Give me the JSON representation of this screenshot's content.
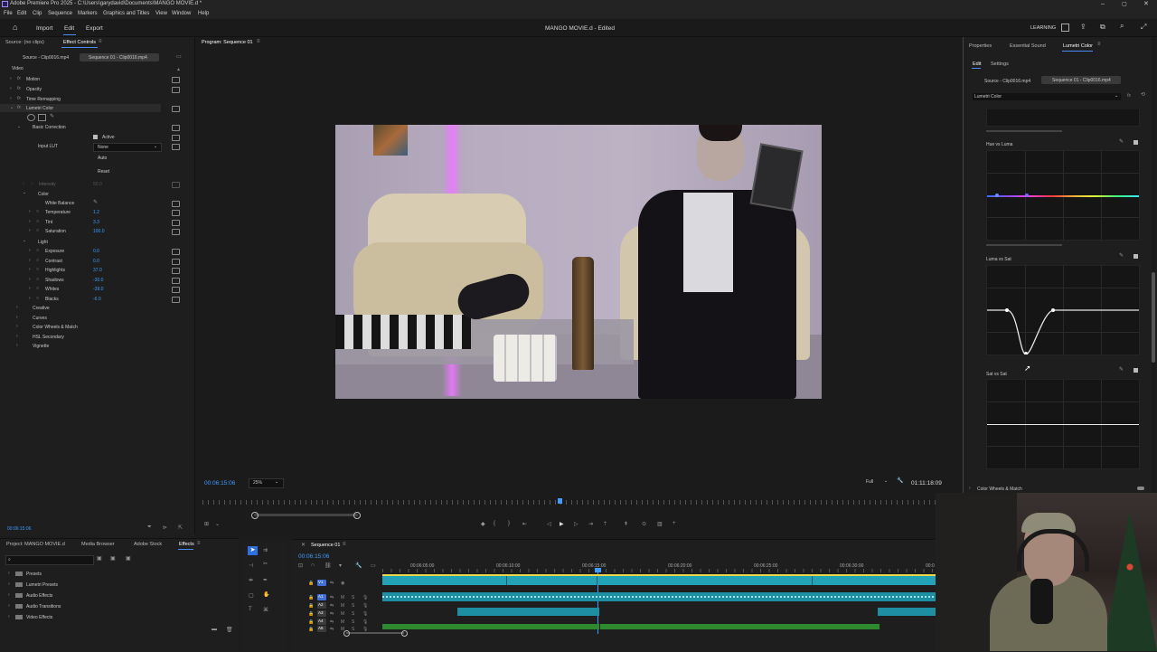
{
  "window": {
    "title": "Adobe Premiere Pro 2025 - C:\\Users\\garydavid\\Documents\\MANGO MOVIE.d *"
  },
  "menu": [
    "File",
    "Edit",
    "Clip",
    "Sequence",
    "Markers",
    "Graphics and Titles",
    "View",
    "Window",
    "Help"
  ],
  "workspace": {
    "tabs": [
      "Import",
      "Edit",
      "Export"
    ],
    "active": "Edit",
    "project_title": "MANGO MOVIE.d - Edited",
    "learning": "LEARNING"
  },
  "effect_controls": {
    "tabs": [
      "Source: (no clips)",
      "Effect Controls"
    ],
    "source_label": "Source - Clip0016.mp4",
    "sequence_label": "Sequence 01 - Clip0016.mp4",
    "video_label": "Video",
    "effects": [
      "Motion",
      "Opacity",
      "Time Remapping",
      "Lumetri Color"
    ],
    "basic_correction": "Basic Correction",
    "active_label": "Active",
    "input_lut_label": "Input LUT",
    "input_lut_value": "None",
    "auto_btn": "Auto",
    "reset_btn": "Reset",
    "intensity_label": "Intensity",
    "intensity_value": "50.0",
    "color_label": "Color",
    "white_balance": "White Balance",
    "params_color": [
      {
        "name": "Temperature",
        "value": "1.2"
      },
      {
        "name": "Tint",
        "value": "3.3"
      },
      {
        "name": "Saturation",
        "value": "100.0"
      }
    ],
    "light_label": "Light",
    "params_light": [
      {
        "name": "Exposure",
        "value": "0.0"
      },
      {
        "name": "Contrast",
        "value": "0.0"
      },
      {
        "name": "Highlights",
        "value": "37.0"
      },
      {
        "name": "Shadows",
        "value": "-30.0"
      },
      {
        "name": "Whites",
        "value": "-39.0"
      },
      {
        "name": "Blacks",
        "value": "-6.0"
      }
    ],
    "sections": [
      "Creative",
      "Curves",
      "Color Wheels & Match",
      "HSL Secondary",
      "Vignette"
    ],
    "timecode": "00:06:15:06"
  },
  "program": {
    "title": "Program: Sequence 01",
    "timecode": "00:06:15:06",
    "zoom": "25%",
    "quality": "Full",
    "duration": "01:11:18:09"
  },
  "lumetri_panel": {
    "tabs": [
      "Properties",
      "Essential Sound",
      "Lumetri Color"
    ],
    "subtabs": [
      "Edit",
      "Settings"
    ],
    "source_label": "Source - Clip0016.mp4",
    "sequence_label": "Sequence 01 - Clip0016.mp4",
    "effect_select": "Lumetri Color",
    "curves": [
      "Hue vs Luma",
      "Luma vs Sat",
      "Sat vs Sat"
    ],
    "footer": "Color Wheels & Match"
  },
  "project_panel": {
    "tabs": [
      "Project: MANGO MOVIE.d",
      "Media Browser",
      "Adobe Stock",
      "Effects"
    ],
    "active": "Effects",
    "folders": [
      "Presets",
      "Lumetri Presets",
      "Audio Effects",
      "Audio Transitions",
      "Video Effects"
    ]
  },
  "timeline": {
    "tab": "Sequence 01",
    "timecode": "00:06:15:06",
    "ruler": [
      "00:06:05:00",
      "00:06:10:00",
      "00:06:15:00",
      "00:06:20:00",
      "00:06:25:00",
      "00:06:30:00",
      "00:0"
    ],
    "tracks": [
      "V1",
      "A1",
      "A2",
      "A3",
      "A4",
      "A5"
    ]
  }
}
